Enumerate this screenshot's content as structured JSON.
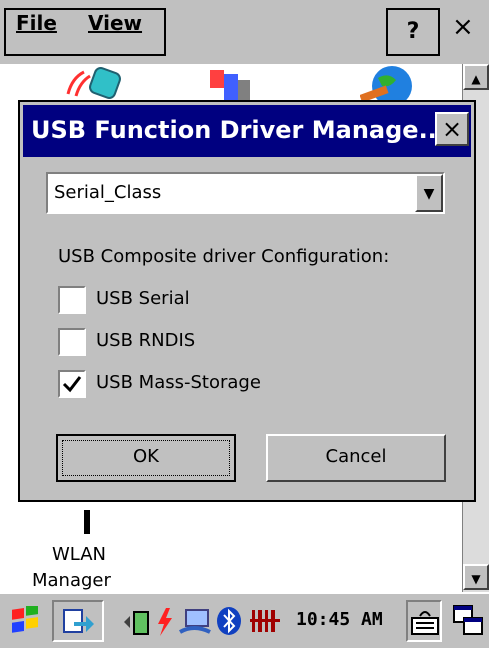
{
  "menubar": {
    "file_label": "File",
    "view_label": "View",
    "help_label": "?",
    "close_label": "×"
  },
  "desktop": {
    "wlan_label_line1": "WLAN",
    "wlan_label_line2": "Manager"
  },
  "dialog": {
    "title": "USB Function Driver Manage...",
    "close_label": "×",
    "select_value": "Serial_Class",
    "config_label": "USB Composite driver Configuration:",
    "options": [
      {
        "label": "USB Serial",
        "checked": false
      },
      {
        "label": "USB RNDIS",
        "checked": false
      },
      {
        "label": "USB Mass-Storage",
        "checked": true
      }
    ],
    "ok_label": "OK",
    "cancel_label": "Cancel"
  },
  "taskbar": {
    "clock": "10:45 AM"
  },
  "icons": {
    "start": "windows-flag-icon",
    "task": "app-task-icon",
    "battery": "battery-icon",
    "power": "power-icon",
    "network": "network-icon",
    "bluetooth": "bluetooth-icon",
    "barcode": "barcode-icon",
    "keyboard": "keyboard-icon",
    "switch": "switch-windows-icon"
  }
}
